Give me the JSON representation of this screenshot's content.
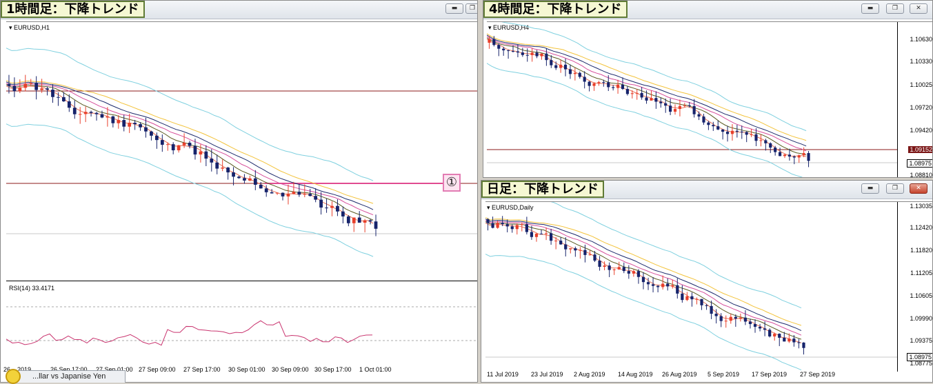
{
  "windows": {
    "h1": {
      "title": "1時間足：下降トレンド",
      "symbol": "EURUSD,H1",
      "rsi_label": "RSI(14) 33.4171",
      "marker": "①",
      "time_labels": [
        "26 ...2019",
        "26 Sep 17:00",
        "27 Sep 01:00",
        "27 Sep 09:00",
        "27 Sep 17:00",
        "30 Sep 01:00",
        "30 Sep 09:00",
        "30 Sep 17:00",
        "1 Oct 01:00"
      ]
    },
    "h4": {
      "title": "4時間足：下降トレンド",
      "symbol": "EURUSD,H4",
      "prices": [
        "1.10630",
        "1.10330",
        "1.10025",
        "1.09720",
        "1.09420",
        "1.09152",
        "1.08975",
        "1.08810"
      ],
      "highlight_price": "1.08975",
      "red_price": "1.09152",
      "buttons": {
        "min": "▬",
        "max": "❐",
        "close": "✕"
      }
    },
    "daily": {
      "title": "日足：下降トレンド",
      "symbol": "EURUSD,Daily",
      "prices": [
        "1.13035",
        "1.12420",
        "1.11820",
        "1.11205",
        "1.10605",
        "1.09990",
        "1.09375",
        "1.08975",
        "1.08775"
      ],
      "highlight_price": "1.08975",
      "time_labels": [
        "11 Jul 2019",
        "23 Jul 2019",
        "2 Aug 2019",
        "14 Aug 2019",
        "26 Aug 2019",
        "5 Sep 2019",
        "17 Sep 2019",
        "27 Sep 2019"
      ]
    }
  },
  "bottom_tab": {
    "label": "...llar vs Japanise Yen"
  },
  "colors": {
    "bull": "#e8402b",
    "bear": "#16236b",
    "bollinger": "#7ed0df",
    "ma_yellow": "#f3c33b",
    "ma_pink": "#d64e9a",
    "ma_navy": "#1c2a6b",
    "ma_olive": "#5a5a20",
    "ma_red": "#e8735a",
    "hline": "#8b1a1a",
    "rsi": "#c9336e"
  }
}
